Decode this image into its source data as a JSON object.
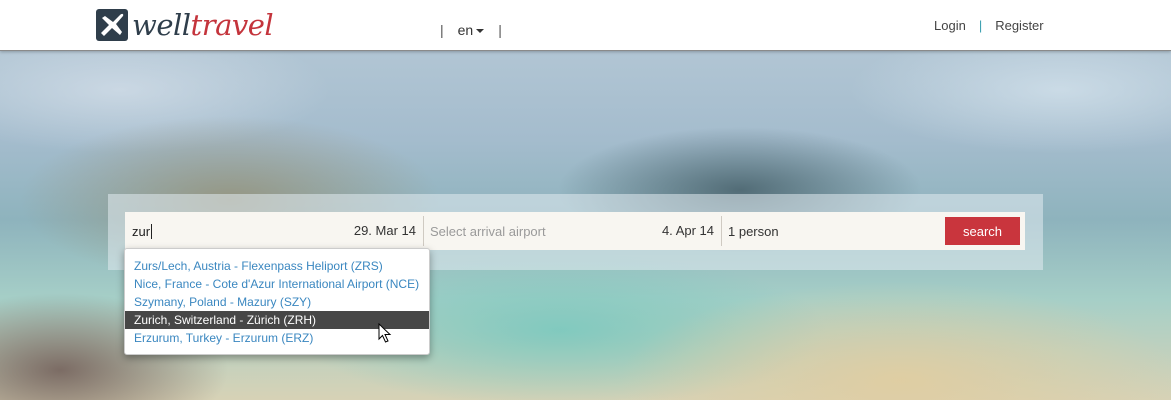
{
  "brand": {
    "name_part1": "well",
    "name_part2": "travel",
    "logo_icon": "airplane-logo-icon"
  },
  "header": {
    "separator": "|",
    "language": "en",
    "login": "Login",
    "register": "Register"
  },
  "search": {
    "departure_value": "zur",
    "departure_date": "29. Mar 14",
    "arrival_placeholder": "Select arrival airport",
    "return_date": "4. Apr 14",
    "passengers": "1 person",
    "button": "search"
  },
  "autocomplete": {
    "items": [
      "Zurs/Lech, Austria - Flexenpass Heliport (ZRS)",
      "Nice, France - Cote d'Azur International Airport (NCE)",
      "Szymany, Poland - Mazury (SZY)",
      "Zurich, Switzerland - Zürich (ZRH)",
      "Erzurum, Turkey - Erzurum (ERZ)"
    ],
    "highlighted": "Zurich, Switzerland - Zürich (ZRH)"
  },
  "colors": {
    "brand_dark": "#2f3e4b",
    "brand_red": "#c4343c",
    "link_blue": "#3a87c0",
    "button_red": "#c9353d"
  }
}
